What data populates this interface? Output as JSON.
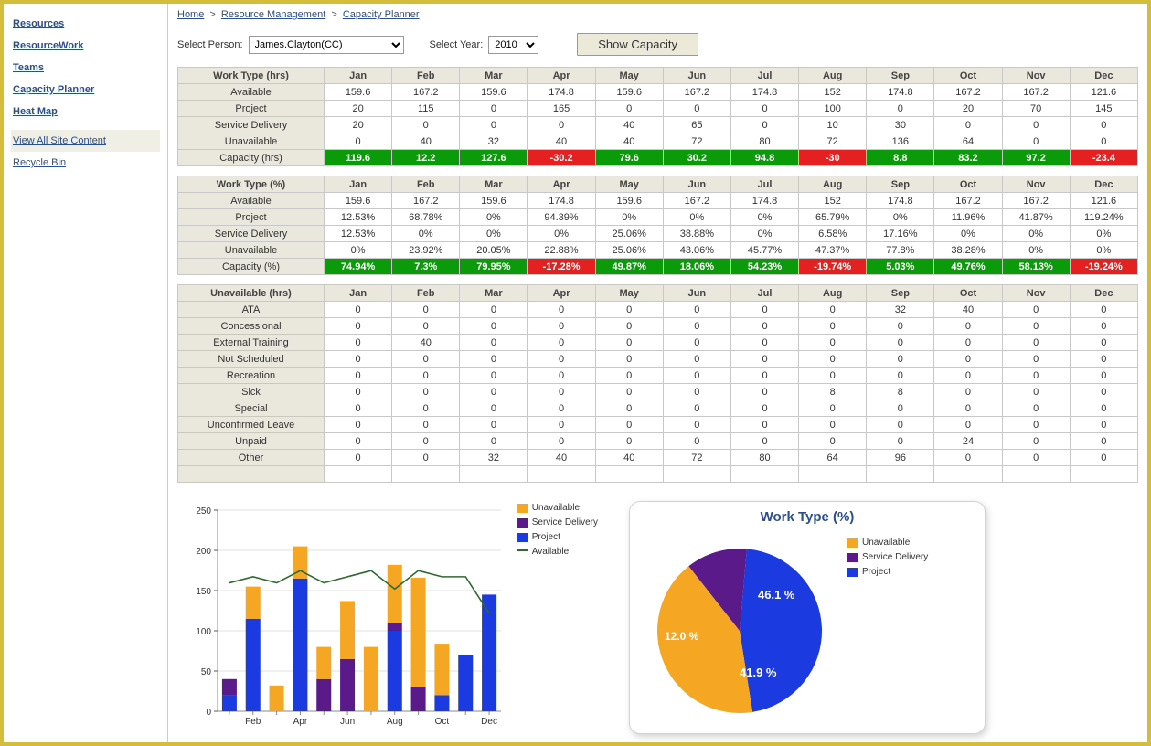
{
  "breadcrumb": {
    "home": "Home",
    "rm": "Resource Management",
    "cp": "Capacity Planner"
  },
  "sidebar": {
    "items": [
      "Resources",
      "ResourceWork",
      "Teams",
      "Capacity Planner",
      "Heat Map"
    ],
    "site": "View All Site Content",
    "recycle": "Recycle Bin"
  },
  "filters": {
    "personLabel": "Select Person:",
    "personSelected": "James.Clayton(CC)",
    "yearLabel": "Select Year:",
    "yearSelected": "2010",
    "button": "Show Capacity"
  },
  "months": [
    "Jan",
    "Feb",
    "Mar",
    "Apr",
    "May",
    "Jun",
    "Jul",
    "Aug",
    "Sep",
    "Oct",
    "Nov",
    "Dec"
  ],
  "table1": {
    "header": "Work Type (hrs)",
    "rows": [
      {
        "label": "Available",
        "v": [
          159.6,
          167.2,
          159.6,
          174.8,
          159.6,
          167.2,
          174.8,
          152,
          174.8,
          167.2,
          167.2,
          121.6
        ]
      },
      {
        "label": "Project",
        "v": [
          20,
          115,
          0,
          165,
          0,
          0,
          0,
          100,
          0,
          20,
          70,
          145
        ]
      },
      {
        "label": "Service Delivery",
        "v": [
          20,
          0,
          0,
          0,
          40,
          65,
          0,
          10,
          30,
          0,
          0,
          0
        ]
      },
      {
        "label": "Unavailable",
        "v": [
          0,
          40,
          32,
          40,
          40,
          72,
          80,
          72,
          136,
          64,
          0,
          0
        ]
      },
      {
        "label": "Capacity (hrs)",
        "v": [
          119.6,
          12.2,
          127.6,
          -30.2,
          79.6,
          30.2,
          94.8,
          -30,
          8.8,
          83.2,
          97.2,
          -23.4
        ],
        "color": true
      }
    ]
  },
  "table2": {
    "header": "Work Type (%)",
    "rows": [
      {
        "label": "Available",
        "v": [
          "159.6",
          "167.2",
          "159.6",
          "174.8",
          "159.6",
          "167.2",
          "174.8",
          "152",
          "174.8",
          "167.2",
          "167.2",
          "121.6"
        ]
      },
      {
        "label": "Project",
        "v": [
          "12.53%",
          "68.78%",
          "0%",
          "94.39%",
          "0%",
          "0%",
          "0%",
          "65.79%",
          "0%",
          "11.96%",
          "41.87%",
          "119.24%"
        ]
      },
      {
        "label": "Service Delivery",
        "v": [
          "12.53%",
          "0%",
          "0%",
          "0%",
          "25.06%",
          "38.88%",
          "0%",
          "6.58%",
          "17.16%",
          "0%",
          "0%",
          "0%"
        ]
      },
      {
        "label": "Unavailable",
        "v": [
          "0%",
          "23.92%",
          "20.05%",
          "22.88%",
          "25.06%",
          "43.06%",
          "45.77%",
          "47.37%",
          "77.8%",
          "38.28%",
          "0%",
          "0%"
        ]
      },
      {
        "label": "Capacity (%)",
        "v": [
          "74.94%",
          "7.3%",
          "79.95%",
          "-17.28%",
          "49.87%",
          "18.06%",
          "54.23%",
          "-19.74%",
          "5.03%",
          "49.76%",
          "58.13%",
          "-19.24%"
        ],
        "color": true,
        "num": [
          74.94,
          7.3,
          79.95,
          -17.28,
          49.87,
          18.06,
          54.23,
          -19.74,
          5.03,
          49.76,
          58.13,
          -19.24
        ]
      }
    ]
  },
  "table3": {
    "header": "Unavailable (hrs)",
    "rows": [
      {
        "label": "ATA",
        "v": [
          0,
          0,
          0,
          0,
          0,
          0,
          0,
          0,
          32,
          40,
          0,
          0
        ]
      },
      {
        "label": "Concessional",
        "v": [
          0,
          0,
          0,
          0,
          0,
          0,
          0,
          0,
          0,
          0,
          0,
          0
        ]
      },
      {
        "label": "External Training",
        "v": [
          0,
          40,
          0,
          0,
          0,
          0,
          0,
          0,
          0,
          0,
          0,
          0
        ]
      },
      {
        "label": "Not Scheduled",
        "v": [
          0,
          0,
          0,
          0,
          0,
          0,
          0,
          0,
          0,
          0,
          0,
          0
        ]
      },
      {
        "label": "Recreation",
        "v": [
          0,
          0,
          0,
          0,
          0,
          0,
          0,
          0,
          0,
          0,
          0,
          0
        ]
      },
      {
        "label": "Sick",
        "v": [
          0,
          0,
          0,
          0,
          0,
          0,
          0,
          8,
          8,
          0,
          0,
          0
        ]
      },
      {
        "label": "Special",
        "v": [
          0,
          0,
          0,
          0,
          0,
          0,
          0,
          0,
          0,
          0,
          0,
          0
        ]
      },
      {
        "label": "Unconfirmed Leave",
        "v": [
          0,
          0,
          0,
          0,
          0,
          0,
          0,
          0,
          0,
          0,
          0,
          0
        ]
      },
      {
        "label": "Unpaid",
        "v": [
          0,
          0,
          0,
          0,
          0,
          0,
          0,
          0,
          0,
          24,
          0,
          0
        ]
      },
      {
        "label": "Other",
        "v": [
          0,
          0,
          32,
          40,
          40,
          72,
          80,
          64,
          96,
          0,
          0,
          0
        ]
      }
    ]
  },
  "chart_data": [
    {
      "type": "bar-stacked-with-line",
      "categories": [
        "Jan",
        "Feb",
        "Mar",
        "Apr",
        "May",
        "Jun",
        "Jul",
        "Aug",
        "Sep",
        "Oct",
        "Nov",
        "Dec"
      ],
      "series": [
        {
          "name": "Project",
          "color": "#1b3adf",
          "values": [
            20,
            115,
            0,
            165,
            0,
            0,
            0,
            100,
            0,
            20,
            70,
            145
          ]
        },
        {
          "name": "Service Delivery",
          "color": "#5a1a8a",
          "values": [
            20,
            0,
            0,
            0,
            40,
            65,
            0,
            10,
            30,
            0,
            0,
            0
          ]
        },
        {
          "name": "Unavailable",
          "color": "#f5a623",
          "values": [
            0,
            40,
            32,
            40,
            40,
            72,
            80,
            72,
            136,
            64,
            0,
            0
          ]
        }
      ],
      "line": {
        "name": "Available",
        "color": "#2f6a2f",
        "values": [
          159.6,
          167.2,
          159.6,
          174.8,
          159.6,
          167.2,
          174.8,
          152,
          174.8,
          167.2,
          167.2,
          121.6
        ]
      },
      "ylim": [
        0,
        250
      ],
      "xlabel": "",
      "ylabel": ""
    },
    {
      "type": "pie",
      "title": "Work Type (%)",
      "slices": [
        {
          "name": "Unavailable",
          "color": "#f5a623",
          "value": 41.9
        },
        {
          "name": "Service Delivery",
          "color": "#5a1a8a",
          "value": 12.0
        },
        {
          "name": "Project",
          "color": "#1b3adf",
          "value": 46.1
        }
      ]
    }
  ],
  "legend": {
    "unavailable": "Unavailable",
    "serviceDelivery": "Service Delivery",
    "project": "Project",
    "available": "Available"
  }
}
